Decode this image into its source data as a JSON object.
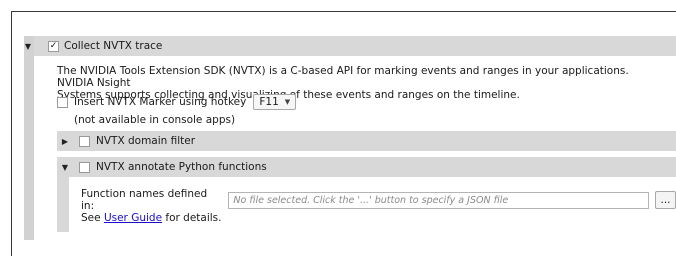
{
  "nvtx": {
    "collect_label": "Collect NVTX trace",
    "collect_checked": "✓",
    "expand_glyph": "▼",
    "collapse_glyph": "▶",
    "description_line1": "The NVIDIA Tools Extension SDK (NVTX) is a C-based API for marking events and ranges in your applications. NVIDIA Nsight",
    "description_line2": "Systems supports collecting and visualizing of these events and ranges on the timeline.",
    "hotkey_label": "Insert NVTX Marker using hotkey",
    "hotkey_value": "F11",
    "console_note": "(not available in console apps)",
    "domain_filter_label": "NVTX domain filter",
    "annotate_python_label": "NVTX annotate Python functions",
    "function_names_label": "Function names defined in:",
    "function_names_placeholder": "No file selected. Click the '...' button to specify a JSON file",
    "browse_button": "...",
    "see_text": "See",
    "user_guide_link": "User Guide",
    "details_text": "for details."
  }
}
